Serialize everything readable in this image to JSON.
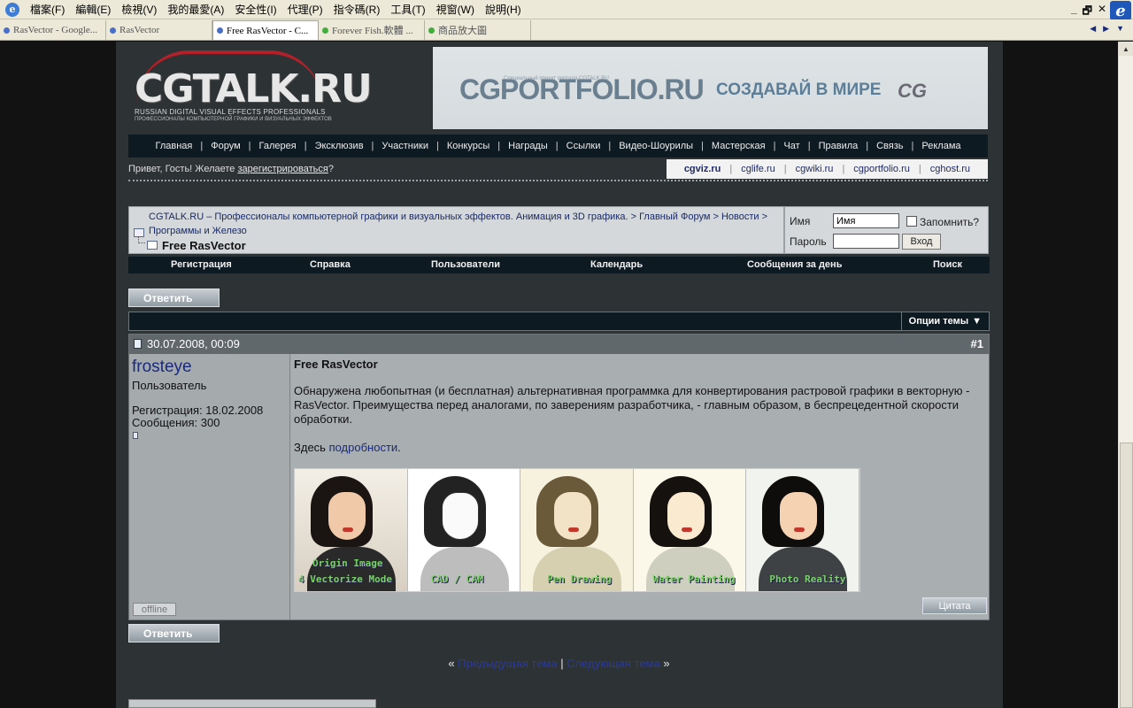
{
  "browser": {
    "menu": [
      "檔案(F)",
      "編輯(E)",
      "檢視(V)",
      "我的最愛(A)",
      "安全性(I)",
      "代理(P)",
      "指令碼(R)",
      "工具(T)",
      "視窗(W)",
      "說明(H)"
    ],
    "window_controls": [
      "_",
      "🗗",
      "✕"
    ],
    "tabs": [
      {
        "label": "RasVector - Google...",
        "dot": "#4a6fc8"
      },
      {
        "label": "RasVector",
        "dot": "#4a6fc8"
      },
      {
        "label": "Free RasVector - C...",
        "dot": "#4a6fc8"
      },
      {
        "label": "Forever Fish.軟體 ...",
        "dot": "#3fae3a"
      },
      {
        "label": "商品放大圖",
        "dot": "#3fae3a"
      }
    ],
    "ie_letter": "e"
  },
  "site": {
    "logo": "CGTALK.RU",
    "logo_sub1": "RUSSIAN DIGITAL VISUAL EFFECTS PROFESSIONALS",
    "logo_sub2": "ПРОФЕССИОНАЛЫ КОМПЬЮТЕРНОЙ ГРАФИКИ И ВИЗУАЛЬНЫХ ЭФФЕКТОВ",
    "banner": {
      "small": "Специальный проект портала CGTALK.RU",
      "logo": "CGPORTFOLIO.RU",
      "tagline": "СОЗДАВАЙ  В МИРЕ",
      "cg": "CG"
    },
    "nav": [
      "Главная",
      "Форум",
      "Галерея",
      "Эксклюзив",
      "Участники",
      "Конкурсы",
      "Награды",
      "Ссылки",
      "Видео-Шоурилы",
      "Мастерская",
      "Чат",
      "Правила",
      "Связь",
      "Реклама"
    ],
    "greeting_prefix": "Привет, Гость! Желаете ",
    "greeting_link": "зарегистрироваться",
    "greeting_suffix": "?",
    "partner_sites": [
      "cgviz.ru",
      "cglife.ru",
      "cgwiki.ru",
      "cgportfolio.ru",
      "cghost.ru"
    ]
  },
  "breadcrumb": {
    "line1": "CGTALK.RU – Профессионалы компьютерной графики и визуальных эффектов. Анимация и 3D графика.  > Главный Форум  > Новости  >",
    "line2": "Программы и Железо",
    "title": "Free RasVector"
  },
  "login": {
    "user_label": "Имя",
    "user_value": "Имя",
    "remember": "Запомнить?",
    "pass_label": "Пароль",
    "button": "Вход"
  },
  "subnav": [
    "Регистрация",
    "Справка",
    "Пользователи",
    "Календарь",
    "Сообщения за день",
    "Поиск"
  ],
  "reply_label": "Ответить",
  "thread_tools": "Опции темы",
  "post": {
    "date": "30.07.2008, 00:09",
    "number": "#1",
    "username": "frosteye",
    "rank": "Пользователь",
    "registered": "Регистрация: 18.02.2008",
    "messages": "Сообщения: 300",
    "offline": "offline",
    "title": "Free RasVector",
    "text": "Обнаружена любопытная (и бесплатная) альтернативная программка для конвертирования растровой графики в векторную - RasVector. Преимущества перед аналогами, по заверениям разработчика, - главным образом, в беспрецедентной скорости обработки.",
    "link_prefix": "Здесь ",
    "link_text": "подробности",
    "link_suffix": ".",
    "image_captions": [
      "Origin Image",
      "4 Vectorize Mode",
      "CAD / CAM",
      "Pen Drawing",
      "Water Painting",
      "Photo Reality"
    ],
    "quote": "Цитата"
  },
  "thread_nav": {
    "open": "« ",
    "prev": "Предыдущая тема",
    "sep": " | ",
    "next": "Следующая тема",
    "close": " »"
  }
}
